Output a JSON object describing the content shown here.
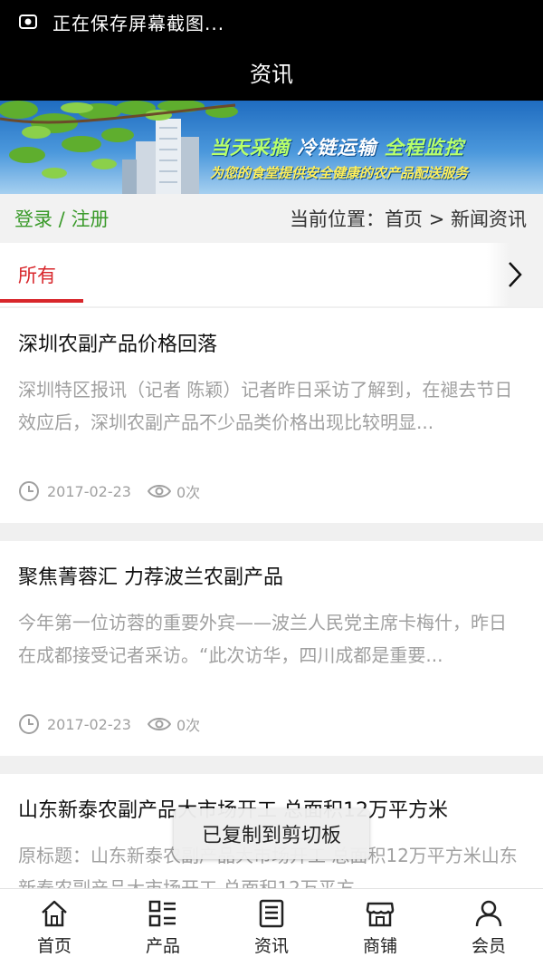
{
  "status_bar": {
    "text": "正在保存屏幕截图..."
  },
  "header": {
    "title": "资讯"
  },
  "banner": {
    "slogan_part1": "当天采摘",
    "slogan_part2": "冷链运输",
    "slogan_part3": "全程监控",
    "subtitle": "为您的食堂提供安全健康的农产品配送服务"
  },
  "location_bar": {
    "login": "登录",
    "separator": " / ",
    "register": "注册",
    "breadcrumb": "当前位置：首页 > 新闻资讯"
  },
  "tabs": {
    "active": "所有"
  },
  "articles": [
    {
      "title": "深圳农副产品价格回落",
      "summary": "深圳特区报讯（记者 陈颖）记者昨日采访了解到，在褪去节日效应后，深圳农副产品不少品类价格出现比较明显...",
      "date": "2017-02-23",
      "views": "0次"
    },
    {
      "title": "聚焦菁蓉汇 力荐波兰农副产品",
      "summary": "今年第一位访蓉的重要外宾——波兰人民党主席卡梅什，昨日在成都接受记者采访。“此次访华，四川成都是重要...",
      "date": "2017-02-23",
      "views": "0次"
    },
    {
      "title": "山东新泰农副产品大市场开工 总面积12万平方米",
      "summary": "原标题：山东新泰农副产品大市场开工 总面积12万平方米山东新泰农副产品大市场开工 总面积12万平方"
    }
  ],
  "toast": {
    "text": "已复制到剪切板"
  },
  "bottom_nav": [
    {
      "label": "首页",
      "icon": "home-icon"
    },
    {
      "label": "产品",
      "icon": "grid-list-icon"
    },
    {
      "label": "资讯",
      "icon": "news-icon"
    },
    {
      "label": "商铺",
      "icon": "shop-icon"
    },
    {
      "label": "会员",
      "icon": "user-icon"
    }
  ],
  "colors": {
    "accent_red": "#d8262b",
    "login_green": "#3a9a2a",
    "muted_gray": "#a0a0a0"
  }
}
